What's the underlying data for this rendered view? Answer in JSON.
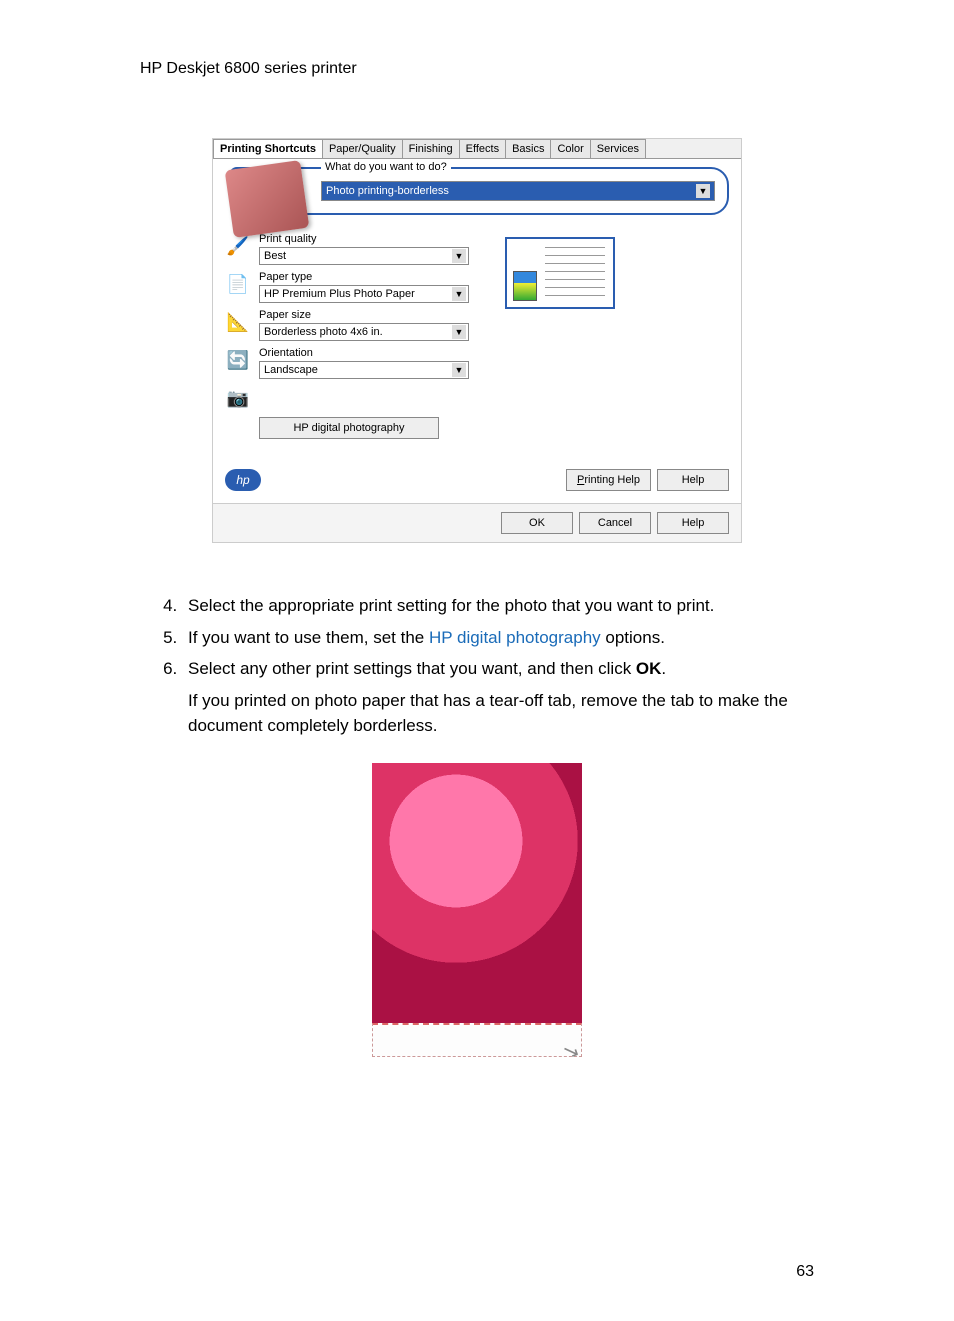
{
  "header": "HP Deskjet 6800 series printer",
  "dialog": {
    "tabs": [
      "Printing Shortcuts",
      "Paper/Quality",
      "Finishing",
      "Effects",
      "Basics",
      "Color",
      "Services"
    ],
    "activeTab": 0,
    "wtdLegend": "What do you want to do?",
    "wtdValue": "Photo printing-borderless",
    "options": {
      "printQuality": {
        "label": "Print quality",
        "value": "Best"
      },
      "paperType": {
        "label": "Paper type",
        "value": "HP Premium Plus Photo Paper"
      },
      "paperSize": {
        "label": "Paper size",
        "value": "Borderless photo 4x6 in."
      },
      "orientation": {
        "label": "Orientation",
        "value": "Landscape"
      }
    },
    "hpDigitalBtn": "HP digital photography",
    "hpLogoText": "hp",
    "printingHelp": "Printing Help",
    "help": "Help",
    "ok": "OK",
    "cancel": "Cancel"
  },
  "steps": {
    "s4": {
      "num": "4.",
      "text": "Select the appropriate print setting for the photo that you want to print."
    },
    "s5": {
      "num": "5.",
      "pre": "If you want to use them, set the ",
      "link": "HP digital photography",
      "post": " options."
    },
    "s6": {
      "num": "6.",
      "pre": "Select any other print settings that you want, and then click ",
      "bold": "OK",
      "post": "."
    },
    "followup": "If you printed on photo paper that has a tear-off tab, remove the tab to make the document completely borderless."
  },
  "pageNumber": "63"
}
